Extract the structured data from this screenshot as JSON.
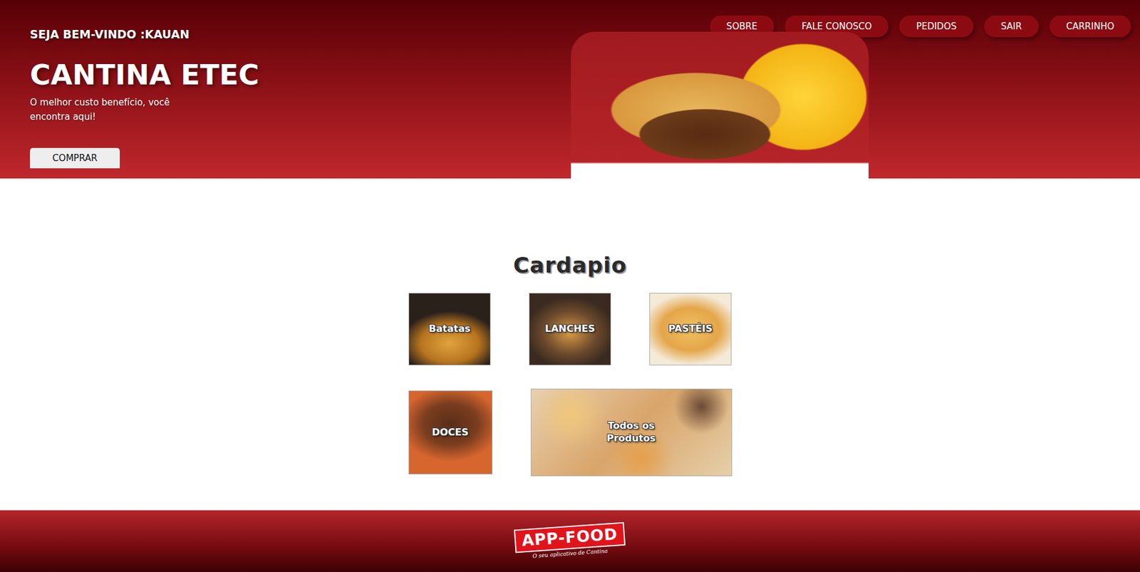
{
  "header": {
    "welcome": "SEJA BEM-VINDO :KAUAN",
    "nav": [
      {
        "label": "SOBRE"
      },
      {
        "label": "FALE CONOSCO"
      },
      {
        "label": "PEDIDOS"
      },
      {
        "label": "SAIR"
      },
      {
        "label": "CARRINHO"
      }
    ]
  },
  "hero": {
    "title": "CANTINA ETEC",
    "subtitle": "O melhor custo benefício, você encontra aqui!",
    "button": "COMPRAR"
  },
  "menu": {
    "title": "Cardapio",
    "rows": [
      [
        {
          "label": "Batatas",
          "kind": "square"
        },
        {
          "label": "LANCHES",
          "kind": "square"
        },
        {
          "label": "PASTÉIS",
          "kind": "square"
        }
      ],
      [
        {
          "label": "DOCES",
          "kind": "tall"
        },
        {
          "label": "Todos os Produtos",
          "kind": "wide"
        }
      ]
    ]
  },
  "footer": {
    "logo": "APP-FOOD",
    "tagline": "O seu aplicativo de Cantina"
  }
}
